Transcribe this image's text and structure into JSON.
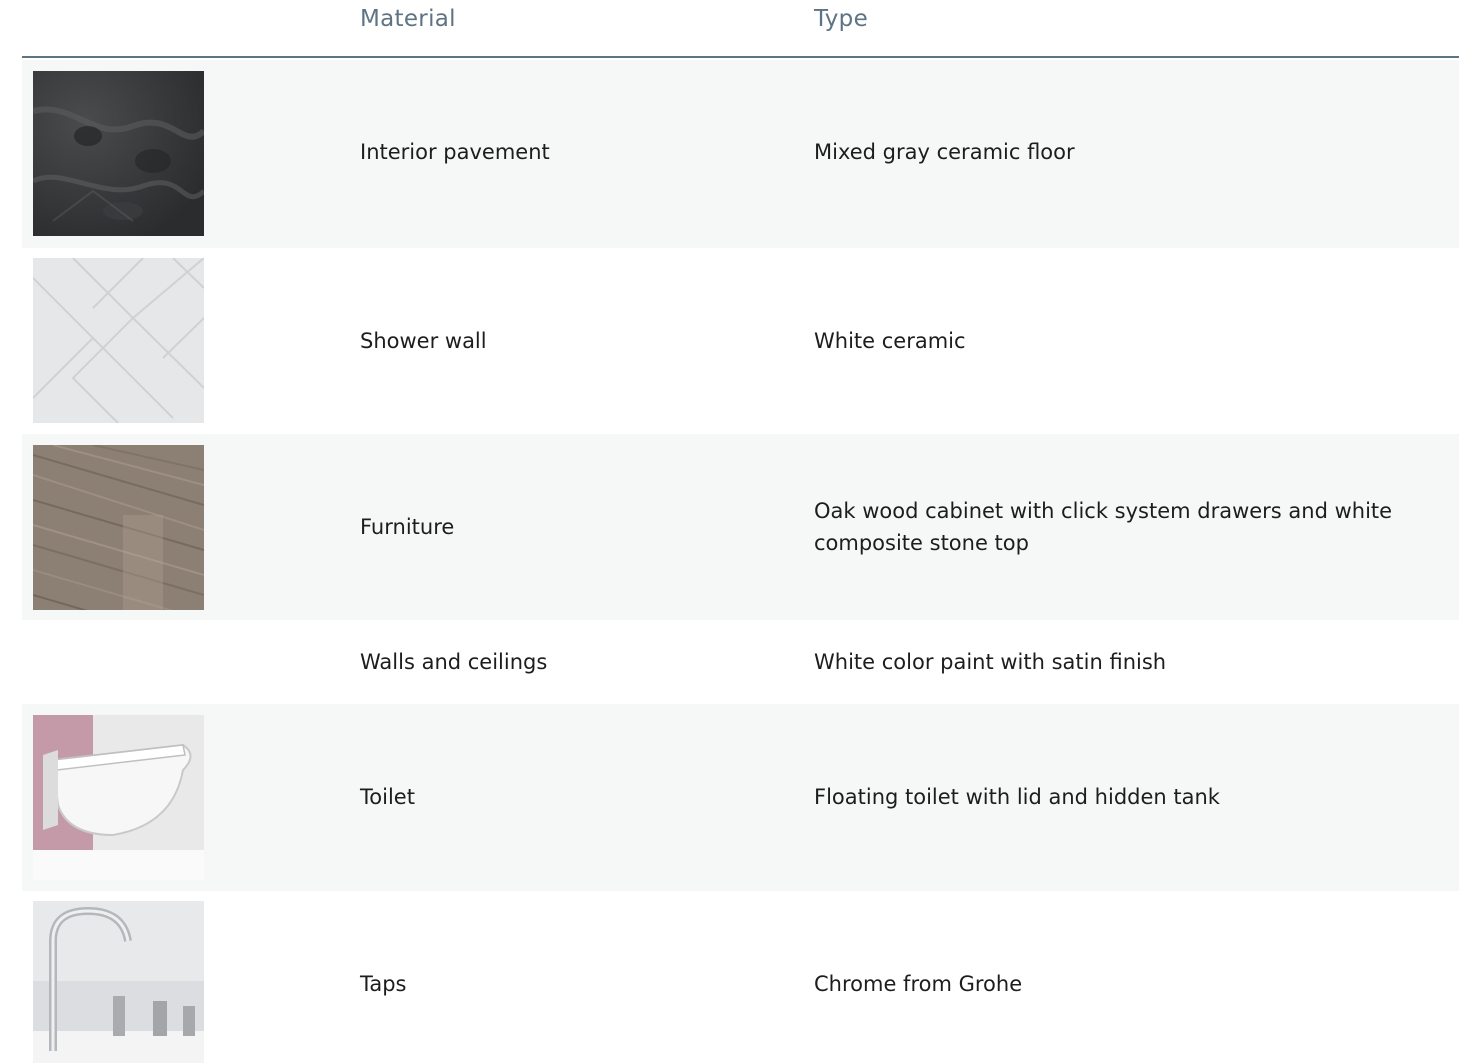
{
  "header": {
    "material_label": "Material",
    "type_label": "Type"
  },
  "rows": [
    {
      "material": "Interior pavement",
      "type": "Mixed gray ceramic floor",
      "image": "dark-gray-marble-swatch"
    },
    {
      "material": "Shower wall",
      "type": "White ceramic",
      "image": "white-herringbone-tile-swatch"
    },
    {
      "material": "Furniture",
      "type": "Oak wood cabinet with click system drawers and white composite stone top",
      "image": "oak-wood-swatch"
    },
    {
      "material": "Walls and ceilings",
      "type": "White color paint with satin finish",
      "image": null
    },
    {
      "material": "Toilet",
      "type": "Floating toilet with lid and hidden tank",
      "image": "wall-hung-toilet-photo"
    },
    {
      "material": "Taps",
      "type": "Chrome from Grohe",
      "image": "chrome-tap-photo"
    }
  ]
}
